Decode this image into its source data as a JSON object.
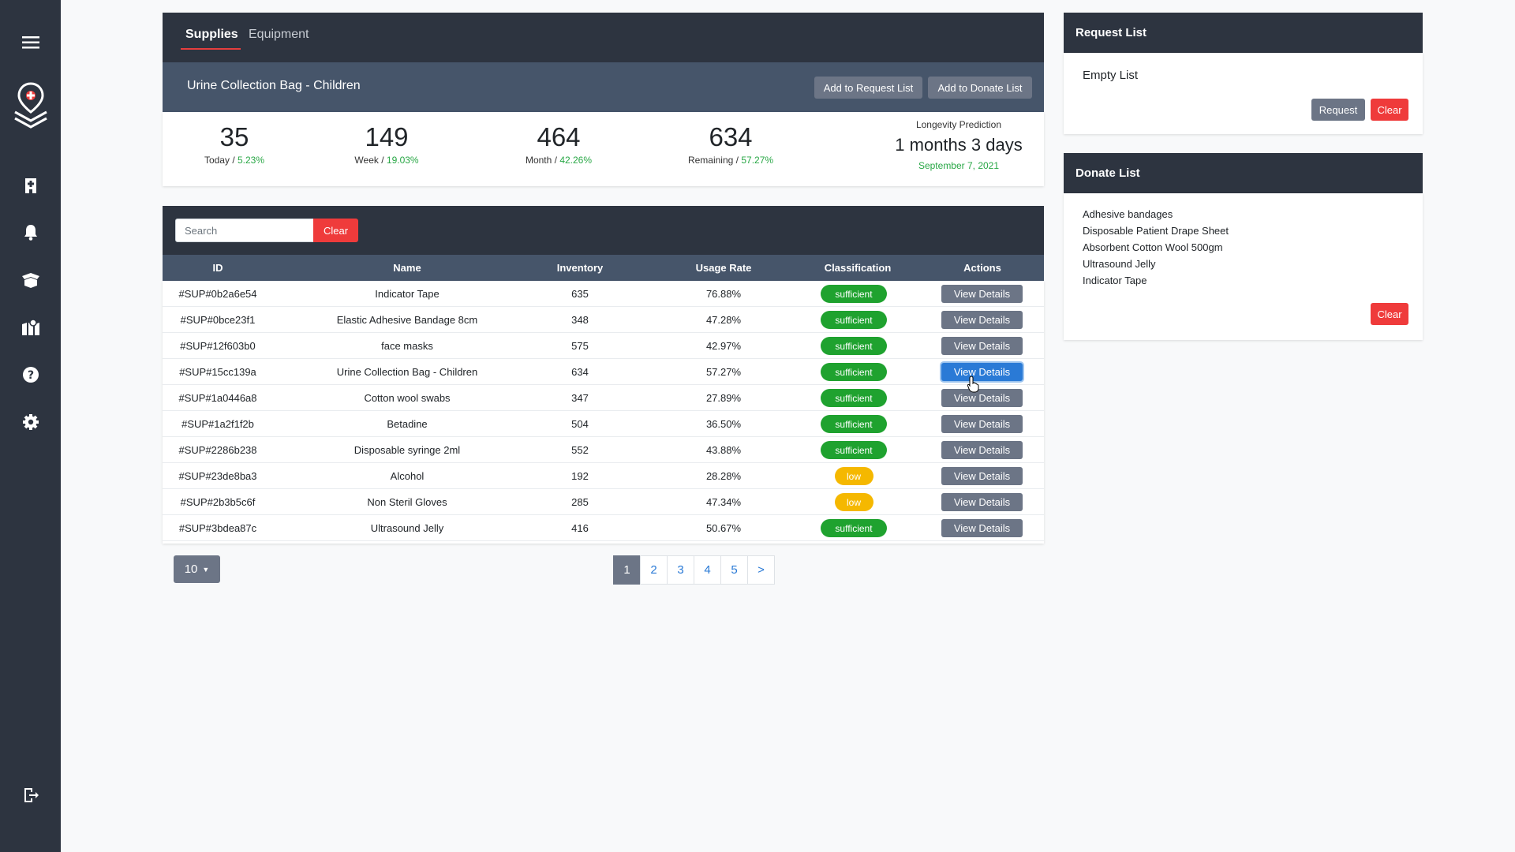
{
  "sidebar": {
    "icons": [
      "menu-icon",
      "logo-icon",
      "hospital-icon",
      "bell-icon",
      "box-icon",
      "map-icon",
      "help-icon",
      "gear-icon",
      "logout-icon"
    ]
  },
  "tabs": [
    {
      "label": "Supplies",
      "active": true
    },
    {
      "label": "Equipment",
      "active": false
    }
  ],
  "item": {
    "title": "Urine Collection Bag - Children",
    "add_request_label": "Add to Request List",
    "add_donate_label": "Add to Donate List"
  },
  "stats": [
    {
      "value": "35",
      "label": "Today",
      "percent": "5.23%"
    },
    {
      "value": "149",
      "label": "Week",
      "percent": "19.03%"
    },
    {
      "value": "464",
      "label": "Month",
      "percent": "42.26%"
    },
    {
      "value": "634",
      "label": "Remaining",
      "percent": "57.27%"
    }
  ],
  "prediction": {
    "label": "Longevity Prediction",
    "value": "1 months 3 days",
    "date": "September 7, 2021"
  },
  "search": {
    "placeholder": "Search",
    "clear_label": "Clear"
  },
  "table": {
    "columns": [
      "ID",
      "Name",
      "Inventory",
      "Usage Rate",
      "Classification",
      "Actions"
    ],
    "action_label": "View Details",
    "rows": [
      {
        "id": "#SUP#0b2a6e54",
        "name": "Indicator Tape",
        "inventory": "635",
        "usage": "76.88%",
        "class": "sufficient"
      },
      {
        "id": "#SUP#0bce23f1",
        "name": "Elastic Adhesive Bandage 8cm",
        "inventory": "348",
        "usage": "47.28%",
        "class": "sufficient"
      },
      {
        "id": "#SUP#12f603b0",
        "name": "face masks",
        "inventory": "575",
        "usage": "42.97%",
        "class": "sufficient"
      },
      {
        "id": "#SUP#15cc139a",
        "name": "Urine Collection Bag - Children",
        "inventory": "634",
        "usage": "57.27%",
        "class": "sufficient"
      },
      {
        "id": "#SUP#1a0446a8",
        "name": "Cotton wool swabs",
        "inventory": "347",
        "usage": "27.89%",
        "class": "sufficient"
      },
      {
        "id": "#SUP#1a2f1f2b",
        "name": "Betadine",
        "inventory": "504",
        "usage": "36.50%",
        "class": "sufficient"
      },
      {
        "id": "#SUP#2286b238",
        "name": "Disposable syringe 2ml",
        "inventory": "552",
        "usage": "43.88%",
        "class": "sufficient"
      },
      {
        "id": "#SUP#23de8ba3",
        "name": "Alcohol",
        "inventory": "192",
        "usage": "28.28%",
        "class": "low"
      },
      {
        "id": "#SUP#2b3b5c6f",
        "name": "Non Steril Gloves",
        "inventory": "285",
        "usage": "47.34%",
        "class": "low"
      },
      {
        "id": "#SUP#3bdea87c",
        "name": "Ultrasound Jelly",
        "inventory": "416",
        "usage": "50.67%",
        "class": "sufficient"
      }
    ]
  },
  "per_page": "10",
  "pagination": [
    "1",
    "2",
    "3",
    "4",
    "5",
    ">"
  ],
  "request_list": {
    "title": "Request List",
    "empty_text": "Empty List",
    "request_label": "Request",
    "clear_label": "Clear"
  },
  "donate_list": {
    "title": "Donate List",
    "items": [
      "Adhesive bandages",
      "Disposable Patient Drape Sheet",
      "Absorbent Cotton Wool 500gm",
      "Ultrasound Jelly",
      "Indicator Tape"
    ],
    "clear_label": "Clear"
  },
  "colors": {
    "sidebar": "#2d3440",
    "accent_red": "#ef3b3b",
    "badge_green": "#1fa22f",
    "badge_yellow": "#f5b800",
    "link_blue": "#2a7ad6"
  }
}
